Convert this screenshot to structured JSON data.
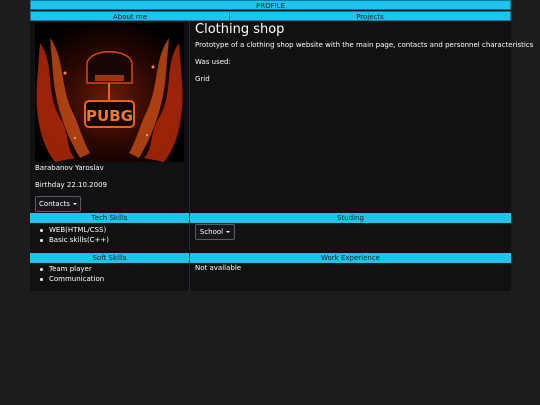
{
  "header": {
    "title": "PROFILE"
  },
  "tabs": [
    {
      "label": "About me"
    },
    {
      "label": "Projects"
    }
  ],
  "profile": {
    "avatar_text": "PUBG",
    "name": "Barabanov Yaroslav",
    "birthday": "Birthday 22.10.2009",
    "contacts_label": "Contacts"
  },
  "project": {
    "title": "Clothing shop",
    "description": "Prototype of a clothing shop website with the main page, contacts and personnel characteristics",
    "used_label": "Was used:",
    "used_value": "Grid"
  },
  "sections": {
    "tech_skills": {
      "title": "Tech Skills",
      "items": [
        "WEB(HTML/CSS)",
        "Basic skills(C++)"
      ]
    },
    "studing": {
      "title": "Studing",
      "select_label": "School"
    },
    "soft_skills": {
      "title": "Soft Skills",
      "items": [
        "Team player",
        "Communication"
      ]
    },
    "work_experience": {
      "title": "Work Experience",
      "text": "Not available"
    }
  },
  "colors": {
    "accent": "#1ec4ec",
    "background": "#1b1c1e",
    "panel": "#101113"
  }
}
